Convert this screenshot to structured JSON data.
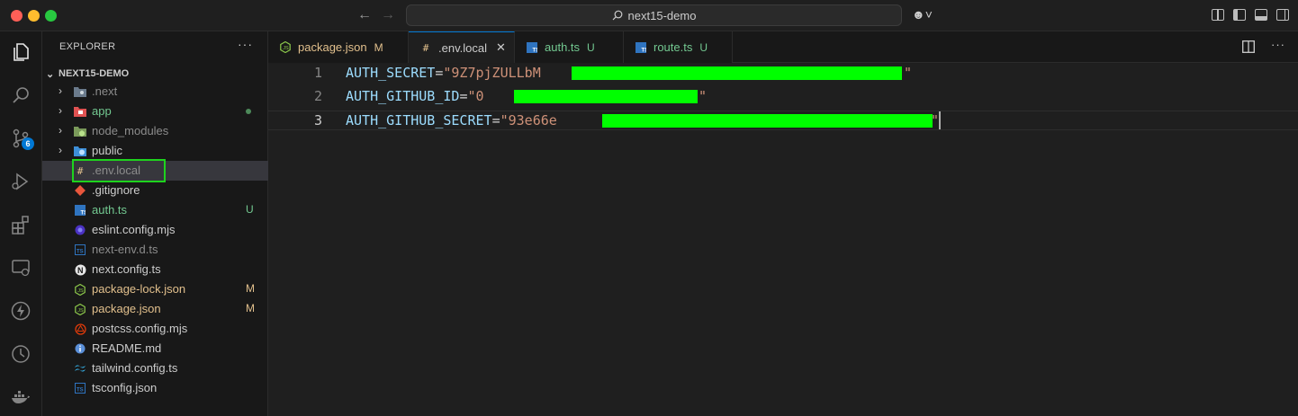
{
  "window": {
    "search_text": "next15-demo"
  },
  "sidebar": {
    "title": "EXPLORER",
    "project": "NEXT15-DEMO",
    "items": [
      {
        "name": ".next",
        "kind": "folder",
        "icon": "folder-settings-icon",
        "color": "#8c8c8c",
        "status": ""
      },
      {
        "name": "app",
        "kind": "folder",
        "icon": "folder-app-icon",
        "color": "#73c991",
        "status": "dot"
      },
      {
        "name": "node_modules",
        "kind": "folder",
        "icon": "folder-node-icon",
        "color": "#8c8c8c",
        "status": ""
      },
      {
        "name": "public",
        "kind": "folder",
        "icon": "folder-public-icon",
        "color": "#cccccc",
        "status": ""
      },
      {
        "name": ".env.local",
        "kind": "file",
        "icon": "env-file-icon",
        "color": "#8c8c8c",
        "status": ""
      },
      {
        "name": ".gitignore",
        "kind": "file",
        "icon": "git-icon",
        "color": "#cccccc",
        "status": ""
      },
      {
        "name": "auth.ts",
        "kind": "file",
        "icon": "typescript-icon",
        "color": "#73c991",
        "status": "U"
      },
      {
        "name": "eslint.config.mjs",
        "kind": "file",
        "icon": "eslint-icon",
        "color": "#cccccc",
        "status": ""
      },
      {
        "name": "next-env.d.ts",
        "kind": "file",
        "icon": "typescript-def-icon",
        "color": "#8c8c8c",
        "status": ""
      },
      {
        "name": "next.config.ts",
        "kind": "file",
        "icon": "next-icon",
        "color": "#cccccc",
        "status": ""
      },
      {
        "name": "package-lock.json",
        "kind": "file",
        "icon": "node-json-icon",
        "color": "#e2c08d",
        "status": "M"
      },
      {
        "name": "package.json",
        "kind": "file",
        "icon": "node-json-icon",
        "color": "#e2c08d",
        "status": "M"
      },
      {
        "name": "postcss.config.mjs",
        "kind": "file",
        "icon": "postcss-icon",
        "color": "#cccccc",
        "status": ""
      },
      {
        "name": "README.md",
        "kind": "file",
        "icon": "info-icon",
        "color": "#cccccc",
        "status": ""
      },
      {
        "name": "tailwind.config.ts",
        "kind": "file",
        "icon": "tailwind-icon",
        "color": "#cccccc",
        "status": ""
      },
      {
        "name": "tsconfig.json",
        "kind": "file",
        "icon": "tsconfig-icon",
        "color": "#cccccc",
        "status": ""
      }
    ]
  },
  "tabs": [
    {
      "label": "package.json",
      "status": "M",
      "icon": "node-json-icon",
      "label_color": "#e2c08d",
      "status_color": "#e2c08d"
    },
    {
      "label": ".env.local",
      "status": "",
      "icon": "env-file-icon",
      "label_color": "#cccccc",
      "status_color": ""
    },
    {
      "label": "auth.ts",
      "status": "U",
      "icon": "typescript-icon",
      "label_color": "#73c991",
      "status_color": "#73c991"
    },
    {
      "label": "route.ts",
      "status": "U",
      "icon": "typescript-icon",
      "label_color": "#73c991",
      "status_color": "#73c991"
    }
  ],
  "editor": {
    "lines": [
      {
        "num": "1",
        "key": "AUTH_SECRET",
        "eq": "=",
        "value_visible": "\"9Z7pjZULLbM",
        "closing_quote": "\""
      },
      {
        "num": "2",
        "key": "AUTH_GITHUB_ID",
        "eq": "=",
        "value_visible": "\"0",
        "closing_quote": "\""
      },
      {
        "num": "3",
        "key": "AUTH_GITHUB_SECRET",
        "eq": "=",
        "value_visible": "\"93e66e",
        "closing_quote": "\""
      }
    ],
    "redaction_color": "#00ff00"
  },
  "activity_bar": {
    "source_control_badge": "6"
  }
}
